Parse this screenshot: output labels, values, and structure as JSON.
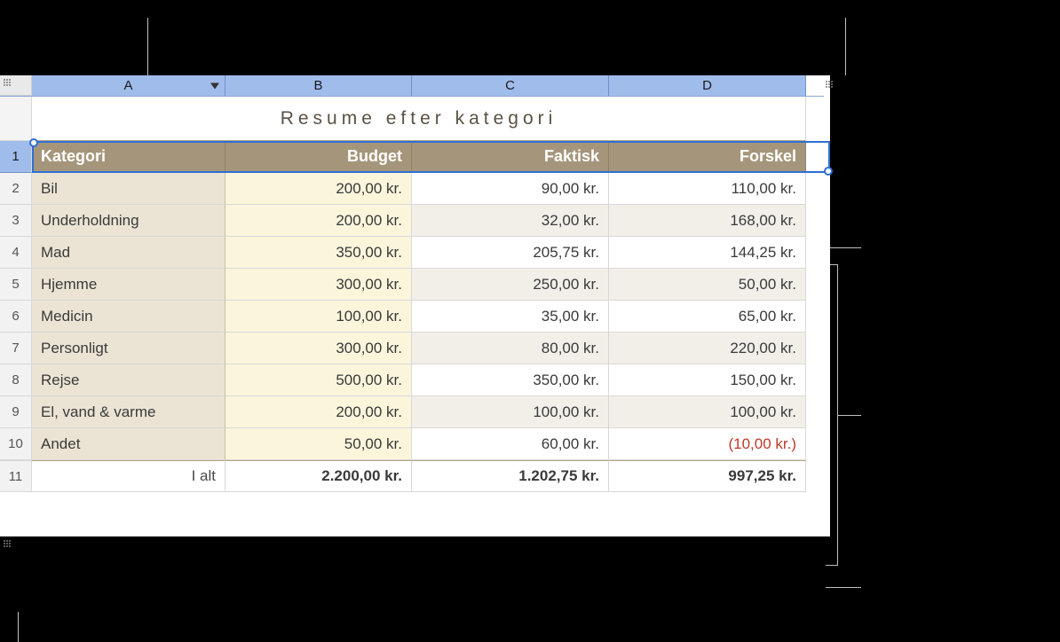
{
  "columns": {
    "a": "A",
    "b": "B",
    "c": "C",
    "d": "D"
  },
  "title": "Resume efter kategori",
  "row_numbers": [
    "1",
    "2",
    "3",
    "4",
    "5",
    "6",
    "7",
    "8",
    "9",
    "10",
    "11"
  ],
  "header_row": {
    "kategori": "Kategori",
    "budget": "Budget",
    "faktisk": "Faktisk",
    "forskel": "Forskel"
  },
  "rows": [
    {
      "kategori": "Bil",
      "budget": "200,00 kr.",
      "faktisk": "90,00 kr.",
      "forskel": "110,00 kr."
    },
    {
      "kategori": "Underholdning",
      "budget": "200,00 kr.",
      "faktisk": "32,00 kr.",
      "forskel": "168,00 kr."
    },
    {
      "kategori": "Mad",
      "budget": "350,00 kr.",
      "faktisk": "205,75 kr.",
      "forskel": "144,25 kr."
    },
    {
      "kategori": "Hjemme",
      "budget": "300,00 kr.",
      "faktisk": "250,00 kr.",
      "forskel": "50,00 kr."
    },
    {
      "kategori": "Medicin",
      "budget": "100,00 kr.",
      "faktisk": "35,00 kr.",
      "forskel": "65,00 kr."
    },
    {
      "kategori": "Personligt",
      "budget": "300,00 kr.",
      "faktisk": "80,00 kr.",
      "forskel": "220,00 kr."
    },
    {
      "kategori": "Rejse",
      "budget": "500,00 kr.",
      "faktisk": "350,00 kr.",
      "forskel": "150,00 kr."
    },
    {
      "kategori": "El, vand & varme",
      "budget": "200,00 kr.",
      "faktisk": "100,00 kr.",
      "forskel": "100,00 kr."
    },
    {
      "kategori": "Andet",
      "budget": "50,00 kr.",
      "faktisk": "60,00 kr.",
      "forskel": "(10,00 kr.)",
      "neg": true
    }
  ],
  "footer": {
    "label": "I alt",
    "budget": "2.200,00 kr.",
    "faktisk": "1.202,75 kr.",
    "forskel": "997,25 kr."
  }
}
